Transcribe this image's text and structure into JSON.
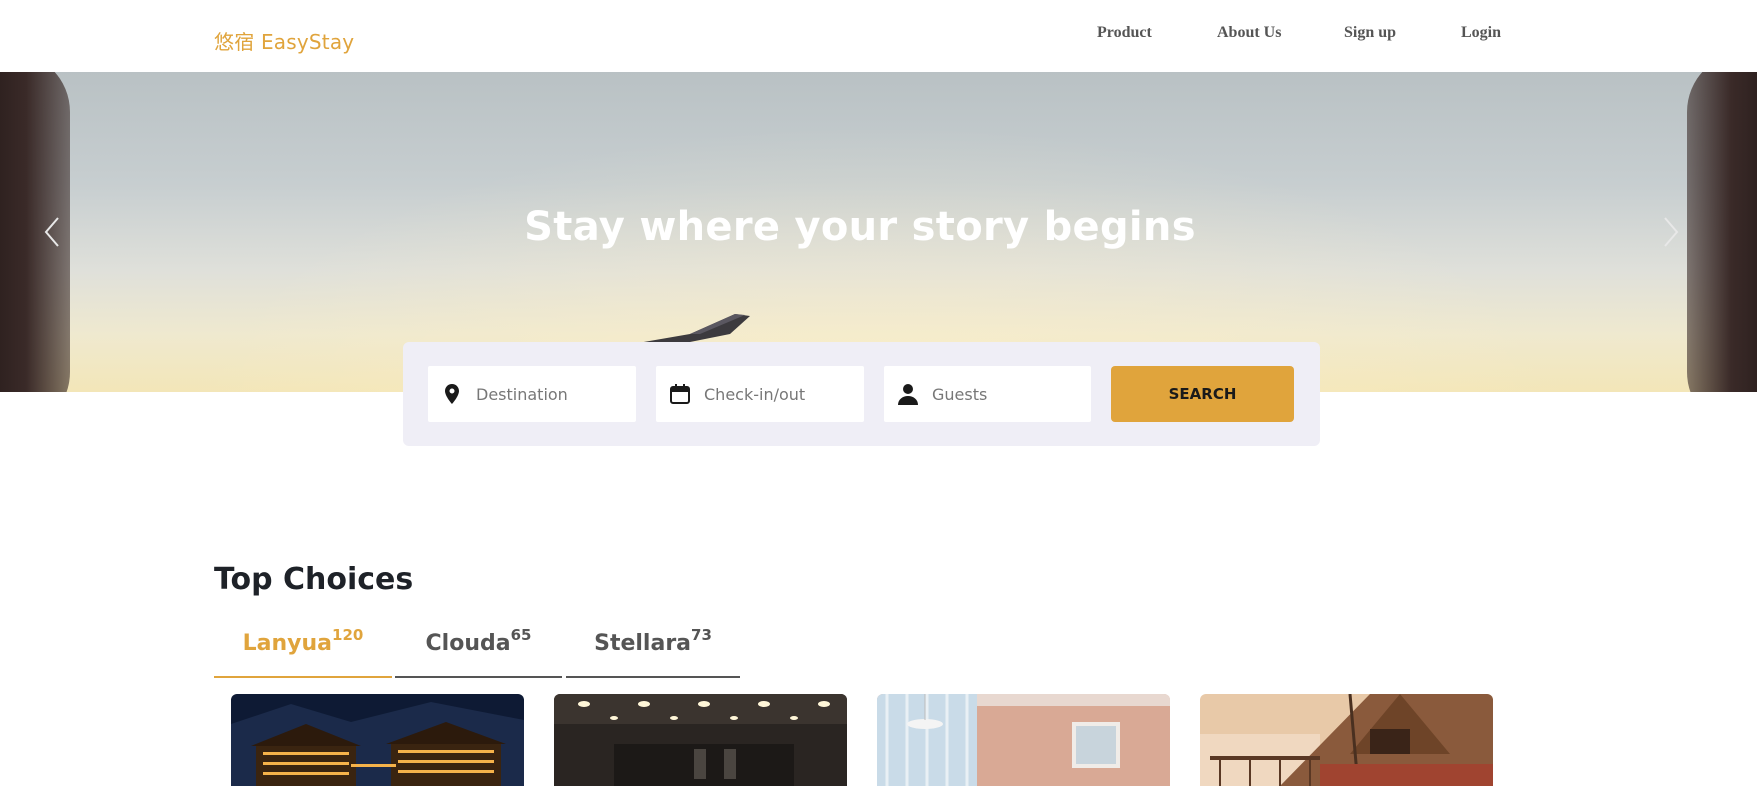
{
  "header": {
    "logo": "悠宿 EasyStay",
    "nav": [
      "Product",
      "About Us",
      "Sign up",
      "Login"
    ]
  },
  "hero": {
    "title": "Stay where your story begins",
    "prev_icon": "chevron-left-icon",
    "next_icon": "chevron-right-icon"
  },
  "search": {
    "destination": {
      "placeholder": "Destination",
      "icon": "map-pin-icon"
    },
    "dates": {
      "placeholder": "Check-in/out",
      "icon": "calendar-icon"
    },
    "guests": {
      "placeholder": "Guests",
      "icon": "person-icon"
    },
    "button": "SEARCH"
  },
  "top_choices": {
    "title": "Top Choices",
    "tabs": [
      {
        "name": "Lanyua",
        "count": "120",
        "active": true
      },
      {
        "name": "Clouda",
        "count": "65",
        "active": false
      },
      {
        "name": "Stellara",
        "count": "73",
        "active": false
      }
    ]
  },
  "colors": {
    "accent": "#e0a43c",
    "panel": "#efeef6",
    "heading": "#1e2228"
  }
}
